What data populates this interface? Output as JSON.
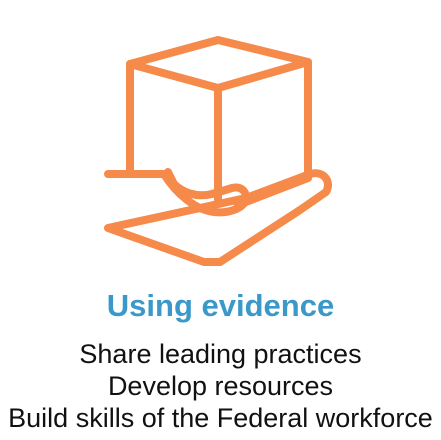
{
  "icon": {
    "name": "hand-holding-box-icon",
    "color": "#f58a4b"
  },
  "title": {
    "text": "Using evidence",
    "color": "#3a99c9"
  },
  "items": [
    "Share leading practices",
    "Develop resources",
    "Build skills of the Federal workforce"
  ]
}
